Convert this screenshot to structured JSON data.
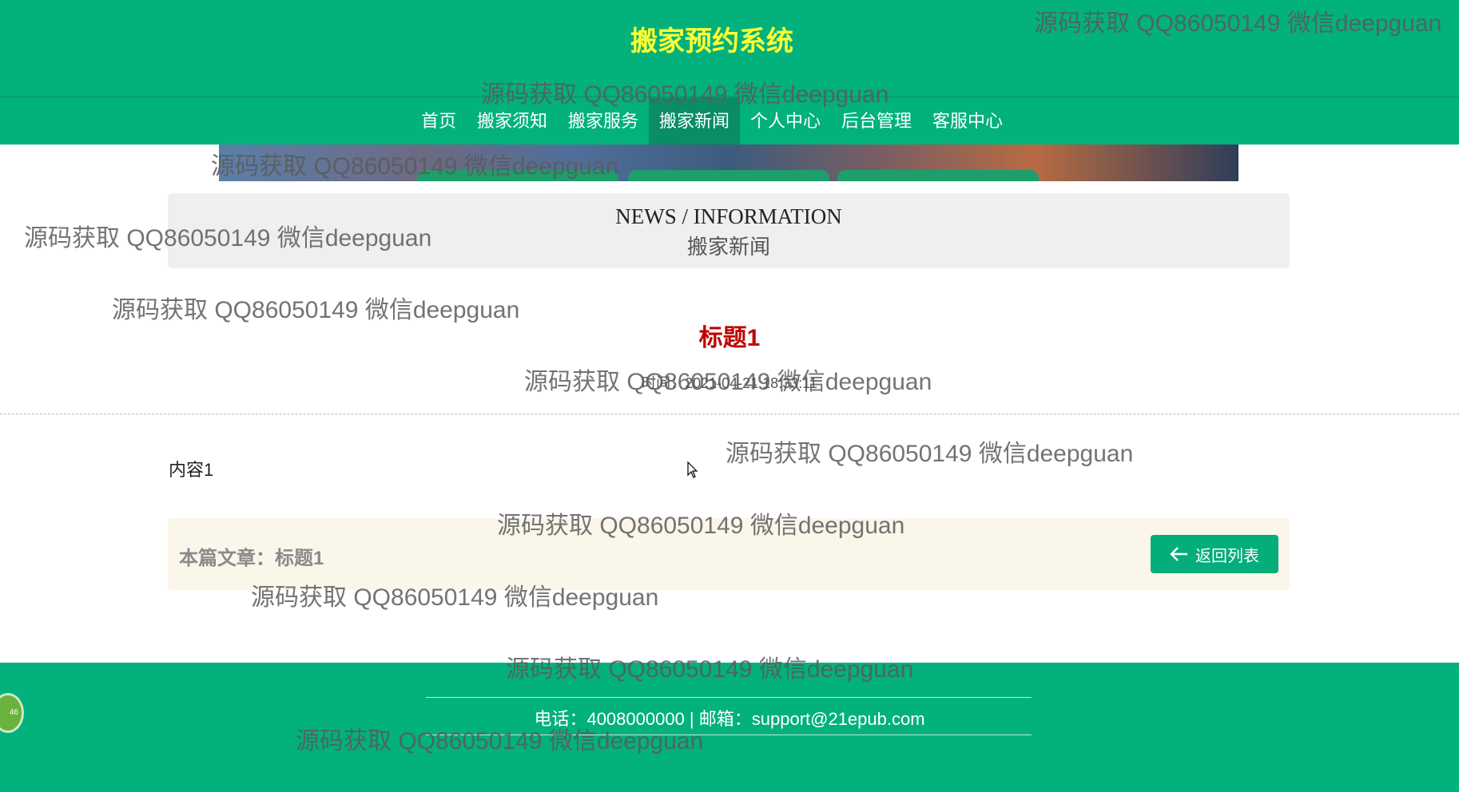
{
  "header": {
    "site_title": "搬家预约系统",
    "nav": [
      {
        "label": "首页",
        "active": false
      },
      {
        "label": "搬家须知",
        "active": false
      },
      {
        "label": "搬家服务",
        "active": false
      },
      {
        "label": "搬家新闻",
        "active": true
      },
      {
        "label": "个人中心",
        "active": false
      },
      {
        "label": "后台管理",
        "active": false
      },
      {
        "label": "客服中心",
        "active": false
      }
    ]
  },
  "news_heading": {
    "english": "NEWS / INFORMATION",
    "chinese": "搬家新闻"
  },
  "article": {
    "title": "标题1",
    "time": "时间：2021-04-21 18:33:11",
    "content": "内容1"
  },
  "bottom_bar": {
    "label": "本篇文章：标题1",
    "back_button": "返回列表"
  },
  "footer": {
    "contact": "电话：4008000000 | 邮箱：support@21epub.com"
  },
  "float_badge": "46",
  "watermark": "源码获取 QQ86050149 微信deepguan",
  "colors": {
    "primary_green": "#02b17c",
    "title_yellow": "#ffff33",
    "article_title_red": "#c00000"
  }
}
